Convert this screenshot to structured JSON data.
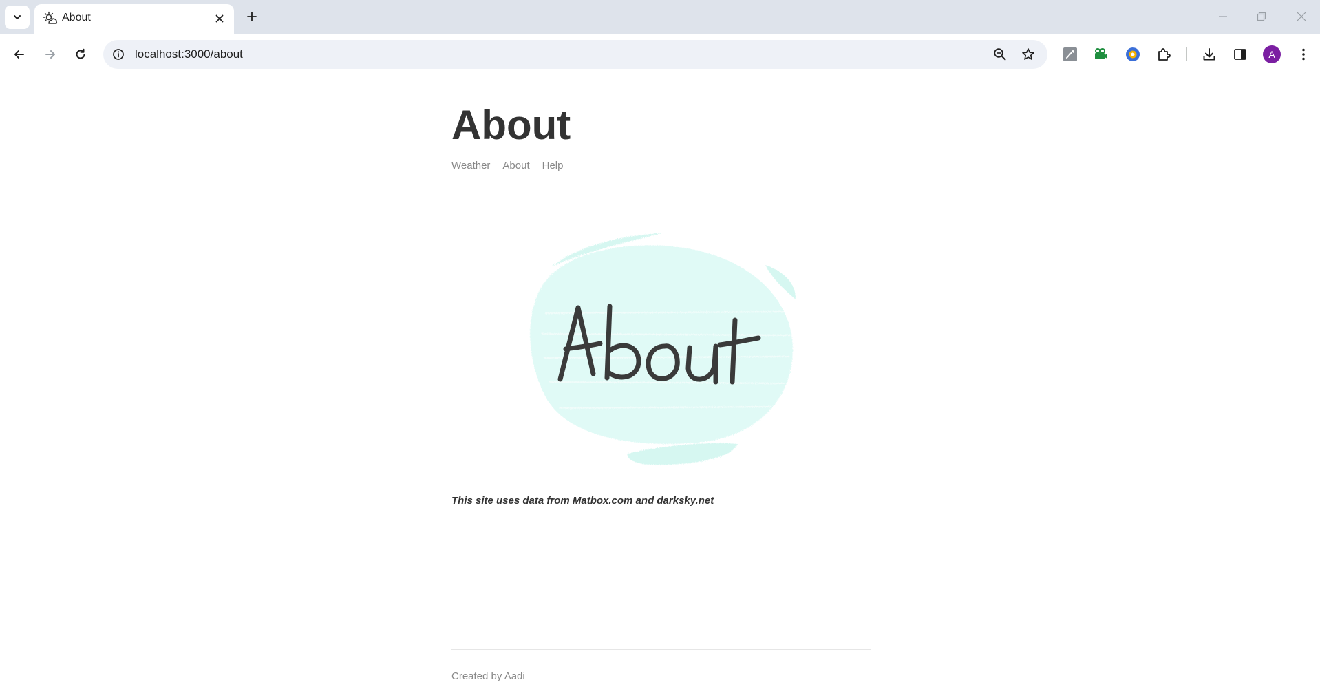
{
  "browser": {
    "tab": {
      "title": "About",
      "favicon": "weather-sun-cloud-icon"
    },
    "address_bar": {
      "url": "localhost:3000/about"
    },
    "profile_initial": "A",
    "accent_color": "#7b1fa2"
  },
  "page": {
    "heading": "About",
    "nav": [
      {
        "label": "Weather"
      },
      {
        "label": "About"
      },
      {
        "label": "Help"
      }
    ],
    "image_text": "About",
    "attribution": "This site uses data from Matbox.com and darksky.net",
    "footer": "Created by Aadi"
  }
}
